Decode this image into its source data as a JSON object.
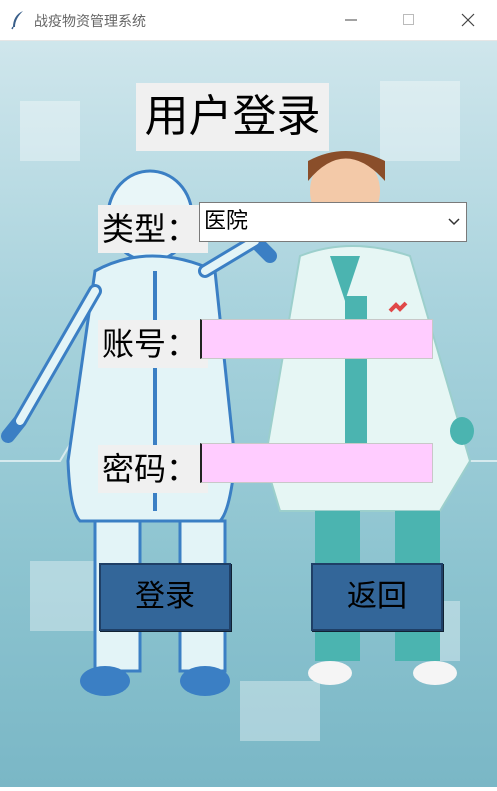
{
  "window": {
    "title": "战疫物资管理系统",
    "controls": {
      "minimize_icon": "minimize-icon",
      "maximize_icon": "maximize-icon",
      "close_icon": "close-icon"
    }
  },
  "login": {
    "title": "用户登录",
    "type_label": "类型：",
    "type_value": "医院",
    "account_label": "账号：",
    "account_value": "",
    "password_label": "密码：",
    "password_value": "",
    "login_button": "登录",
    "back_button": "返回"
  },
  "colors": {
    "input_background": "#ffccff",
    "button_background": "#336699",
    "label_background": "#f0f0f0"
  }
}
